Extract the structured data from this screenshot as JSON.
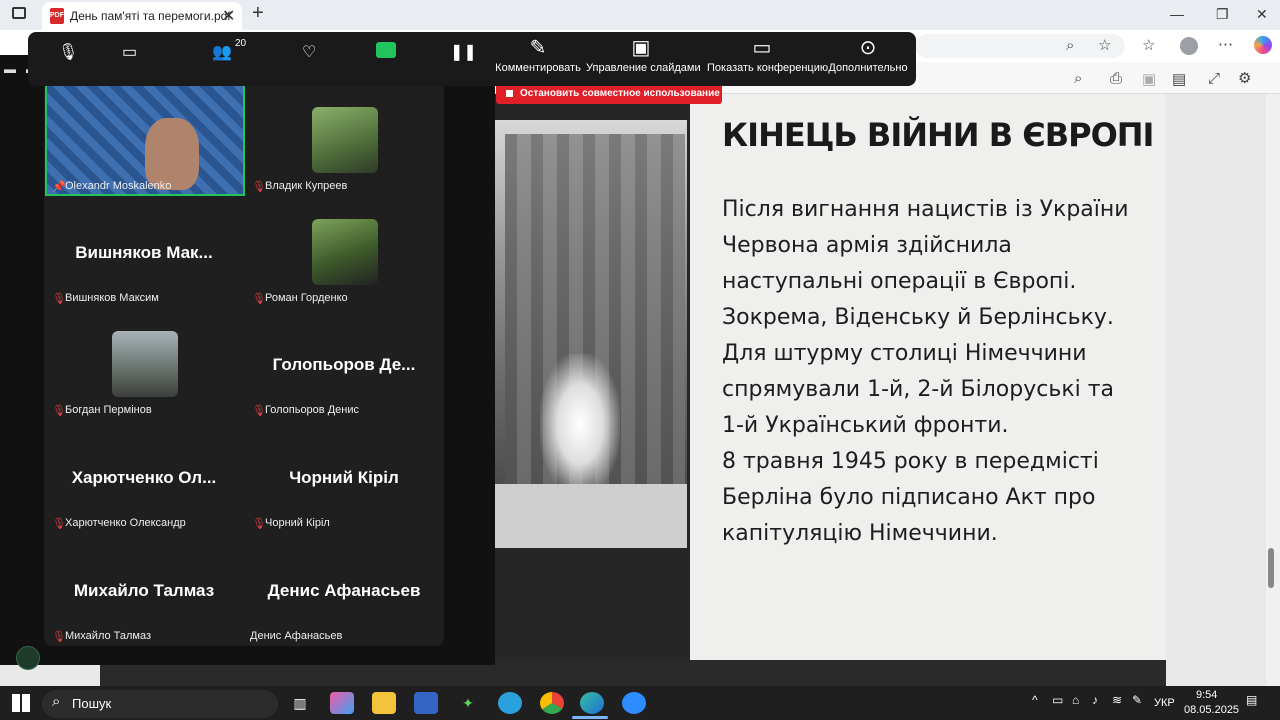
{
  "browser": {
    "tab_title": "День пам'яті та перемоги.pdf",
    "tab_close": "✕",
    "new_tab": "+",
    "pdf_icon_text": "PDF"
  },
  "zoom_toolbar": {
    "participants_count": "20",
    "items": [
      {
        "label": "Комментировать",
        "icon": "pencil-icon"
      },
      {
        "label": "Управление слайдами",
        "icon": "slides-icon"
      },
      {
        "label": "Показать конференцию",
        "icon": "monitor-icon"
      },
      {
        "label": "Дополнительно",
        "icon": "more-icon"
      }
    ],
    "stop_share": "Остановить совместное использование"
  },
  "gallery": {
    "tiles": [
      {
        "name": "Olexandr Moskalenko",
        "big": "",
        "type": "video"
      },
      {
        "name": "Владик Купреев",
        "big": "",
        "type": "photo"
      },
      {
        "name": "Вишняков Максим",
        "big": "Вишняков  Мак...",
        "type": "name"
      },
      {
        "name": "Роман Горденко",
        "big": "",
        "type": "photo"
      },
      {
        "name": "Богдан Пермінов",
        "big": "",
        "type": "photo"
      },
      {
        "name": "Голопьоров Денис",
        "big": "Голопьоров  Де...",
        "type": "name"
      },
      {
        "name": "Харютченко Олександр",
        "big": "Харютченко  Ол...",
        "type": "name"
      },
      {
        "name": "Чорний Кіріл",
        "big": "Чорний Кіріл",
        "type": "name"
      },
      {
        "name": "Михайло Талмаз",
        "big": "Михайло Талмаз",
        "type": "name"
      },
      {
        "name": "Денис Афанасьев",
        "big": "Денис Афанасьев",
        "type": "name"
      }
    ]
  },
  "slide": {
    "title": "КІНЕЦЬ ВІЙНИ В ЄВРОПІ",
    "paragraph1": "Після вигнання нацистів із України Червона армія здійснила наступальні операції в Європі. Зокрема, Віденську й Берлінську. Для штурму столиці Німеччини спрямували 1-й, 2-й Білоруські та 1-й Український фронти.",
    "paragraph2": "8 травня 1945 року в передмісті Берліна було підписано Акт про капітуляцію Німеччини."
  },
  "taskbar": {
    "search_label": "Пошук",
    "language": "УКР",
    "time": "9:54",
    "date": "08.05.2025"
  },
  "colors": {
    "zoom_active_border": "#21c45d",
    "stop_share_red": "#e01e28",
    "mic_off_red": "#e03c3c"
  }
}
